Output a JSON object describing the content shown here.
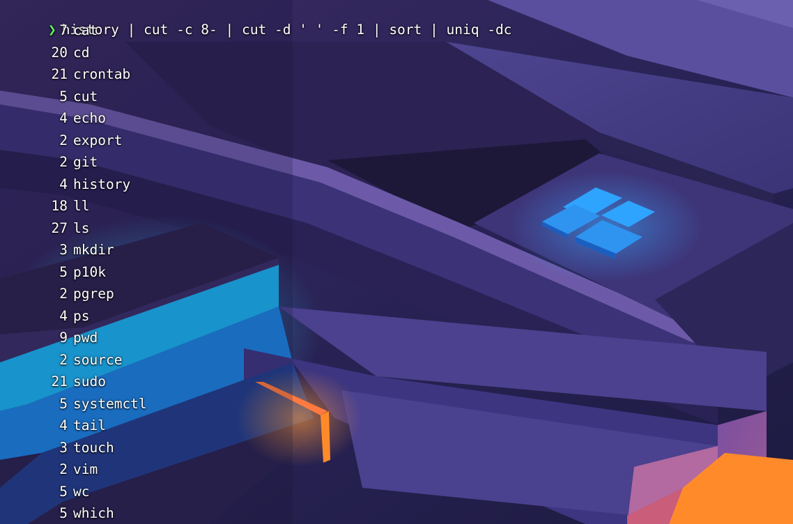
{
  "terminal": {
    "prompt_symbol": "❯",
    "command": "history | cut -c 8- | cut -d ' ' -f 1 | sort | uniq -dc",
    "output": [
      {
        "count": "7",
        "command": "cat"
      },
      {
        "count": "20",
        "command": "cd"
      },
      {
        "count": "21",
        "command": "crontab"
      },
      {
        "count": "5",
        "command": "cut"
      },
      {
        "count": "4",
        "command": "echo"
      },
      {
        "count": "2",
        "command": "export"
      },
      {
        "count": "2",
        "command": "git"
      },
      {
        "count": "4",
        "command": "history"
      },
      {
        "count": "18",
        "command": "ll"
      },
      {
        "count": "27",
        "command": "ls"
      },
      {
        "count": "3",
        "command": "mkdir"
      },
      {
        "count": "5",
        "command": "p10k"
      },
      {
        "count": "2",
        "command": "pgrep"
      },
      {
        "count": "4",
        "command": "ps"
      },
      {
        "count": "9",
        "command": "pwd"
      },
      {
        "count": "2",
        "command": "source"
      },
      {
        "count": "21",
        "command": "sudo"
      },
      {
        "count": "5",
        "command": "systemctl"
      },
      {
        "count": "4",
        "command": "tail"
      },
      {
        "count": "3",
        "command": "touch"
      },
      {
        "count": "2",
        "command": "vim"
      },
      {
        "count": "5",
        "command": "wc"
      },
      {
        "count": "5",
        "command": "which"
      }
    ]
  },
  "colors": {
    "prompt_symbol": "#5ff25f",
    "text": "#ffffff",
    "background": "#231d4a",
    "accent_blue": "#2fa0ff",
    "accent_orange": "#ff8a2a"
  }
}
